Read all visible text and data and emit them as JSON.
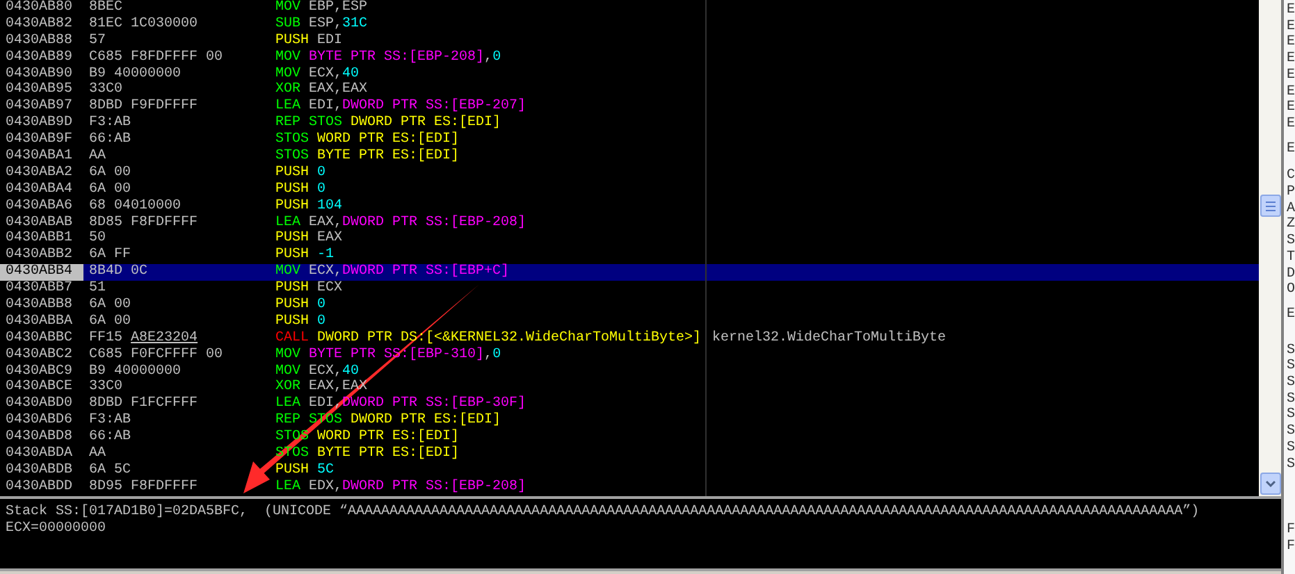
{
  "rows": [
    {
      "address": "0430AB80",
      "hex": "8BEC",
      "selected": false,
      "disasm": [
        {
          "text": "MOV",
          "kind": "op"
        },
        {
          "text": " EBP,ESP",
          "kind": "reg"
        }
      ]
    },
    {
      "address": "0430AB82",
      "hex": "81EC 1C030000",
      "selected": false,
      "disasm": [
        {
          "text": "SUB",
          "kind": "op"
        },
        {
          "text": " ESP,",
          "kind": "reg"
        },
        {
          "text": "31C",
          "kind": "imm"
        }
      ]
    },
    {
      "address": "0430AB88",
      "hex": "57",
      "selected": false,
      "disasm": [
        {
          "text": "PUSH",
          "kind": "stack_op"
        },
        {
          "text": " EDI",
          "kind": "reg"
        }
      ]
    },
    {
      "address": "0430AB89",
      "hex": "C685 F8FDFFFF 00",
      "selected": false,
      "disasm": [
        {
          "text": "MOV",
          "kind": "op"
        },
        {
          "text": " BYTE PTR SS:[EBP-208]",
          "kind": "mem"
        },
        {
          "text": ",",
          "kind": "reg"
        },
        {
          "text": "0",
          "kind": "imm"
        }
      ]
    },
    {
      "address": "0430AB90",
      "hex": "B9 40000000",
      "selected": false,
      "disasm": [
        {
          "text": "MOV",
          "kind": "op"
        },
        {
          "text": " ECX,",
          "kind": "reg"
        },
        {
          "text": "40",
          "kind": "imm"
        }
      ]
    },
    {
      "address": "0430AB95",
      "hex": "33C0",
      "selected": false,
      "disasm": [
        {
          "text": "XOR",
          "kind": "op"
        },
        {
          "text": " EAX,EAX",
          "kind": "reg"
        }
      ]
    },
    {
      "address": "0430AB97",
      "hex": "8DBD F9FDFFFF",
      "selected": false,
      "disasm": [
        {
          "text": "LEA",
          "kind": "op"
        },
        {
          "text": " EDI,",
          "kind": "reg"
        },
        {
          "text": "DWORD PTR SS:[EBP-207]",
          "kind": "mem"
        }
      ]
    },
    {
      "address": "0430AB9D",
      "hex": "F3:AB",
      "selected": false,
      "disasm": [
        {
          "text": "REP STOS",
          "kind": "op"
        },
        {
          "text": " DWORD PTR ES:[EDI]",
          "kind": "ptr"
        }
      ]
    },
    {
      "address": "0430AB9F",
      "hex": "66:AB",
      "selected": false,
      "disasm": [
        {
          "text": "STOS",
          "kind": "op"
        },
        {
          "text": " WORD PTR ES:[EDI]",
          "kind": "ptr"
        }
      ]
    },
    {
      "address": "0430ABA1",
      "hex": "AA",
      "selected": false,
      "disasm": [
        {
          "text": "STOS",
          "kind": "op"
        },
        {
          "text": " BYTE PTR ES:[EDI]",
          "kind": "ptr"
        }
      ]
    },
    {
      "address": "0430ABA2",
      "hex": "6A 00",
      "selected": false,
      "disasm": [
        {
          "text": "PUSH ",
          "kind": "stack_op"
        },
        {
          "text": "0",
          "kind": "imm"
        }
      ]
    },
    {
      "address": "0430ABA4",
      "hex": "6A 00",
      "selected": false,
      "disasm": [
        {
          "text": "PUSH ",
          "kind": "stack_op"
        },
        {
          "text": "0",
          "kind": "imm"
        }
      ]
    },
    {
      "address": "0430ABA6",
      "hex": "68 04010000",
      "selected": false,
      "disasm": [
        {
          "text": "PUSH ",
          "kind": "stack_op"
        },
        {
          "text": "104",
          "kind": "imm"
        }
      ]
    },
    {
      "address": "0430ABAB",
      "hex": "8D85 F8FDFFFF",
      "selected": false,
      "disasm": [
        {
          "text": "LEA",
          "kind": "op"
        },
        {
          "text": " EAX,",
          "kind": "reg"
        },
        {
          "text": "DWORD PTR SS:[EBP-208]",
          "kind": "mem"
        }
      ]
    },
    {
      "address": "0430ABB1",
      "hex": "50",
      "selected": false,
      "disasm": [
        {
          "text": "PUSH",
          "kind": "stack_op"
        },
        {
          "text": " EAX",
          "kind": "reg"
        }
      ]
    },
    {
      "address": "0430ABB2",
      "hex": "6A FF",
      "selected": false,
      "disasm": [
        {
          "text": "PUSH ",
          "kind": "stack_op"
        },
        {
          "text": "-1",
          "kind": "imm"
        }
      ]
    },
    {
      "address": "0430ABB4",
      "hex": "8B4D 0C",
      "selected": true,
      "disasm": [
        {
          "text": "MOV",
          "kind": "op"
        },
        {
          "text": " ECX,",
          "kind": "reg"
        },
        {
          "text": "DWORD PTR SS:[EBP+C]",
          "kind": "mem"
        }
      ]
    },
    {
      "address": "0430ABB7",
      "hex": "51",
      "selected": false,
      "disasm": [
        {
          "text": "PUSH",
          "kind": "stack_op"
        },
        {
          "text": " ECX",
          "kind": "reg"
        }
      ]
    },
    {
      "address": "0430ABB8",
      "hex": "6A 00",
      "selected": false,
      "disasm": [
        {
          "text": "PUSH ",
          "kind": "stack_op"
        },
        {
          "text": "0",
          "kind": "imm"
        }
      ]
    },
    {
      "address": "0430ABBA",
      "hex": "6A 00",
      "selected": false,
      "disasm": [
        {
          "text": "PUSH ",
          "kind": "stack_op"
        },
        {
          "text": "0",
          "kind": "imm"
        }
      ]
    },
    {
      "address": "0430ABBC",
      "hex": "FF15",
      "hex_target": "A8E23204",
      "selected": false,
      "disasm": [
        {
          "text": "CALL",
          "kind": "call"
        },
        {
          "text": " DWORD PTR DS:[<&KERNEL32.WideCharToMultiByte>]",
          "kind": "ptr"
        }
      ],
      "comment": "kernel32.WideCharToMultiByte"
    },
    {
      "address": "0430ABC2",
      "hex": "C685 F0FCFFFF 00",
      "selected": false,
      "disasm": [
        {
          "text": "MOV",
          "kind": "op"
        },
        {
          "text": " BYTE PTR SS:[EBP-310]",
          "kind": "mem"
        },
        {
          "text": ",",
          "kind": "reg"
        },
        {
          "text": "0",
          "kind": "imm"
        }
      ]
    },
    {
      "address": "0430ABC9",
      "hex": "B9 40000000",
      "selected": false,
      "disasm": [
        {
          "text": "MOV",
          "kind": "op"
        },
        {
          "text": " ECX,",
          "kind": "reg"
        },
        {
          "text": "40",
          "kind": "imm"
        }
      ]
    },
    {
      "address": "0430ABCE",
      "hex": "33C0",
      "selected": false,
      "disasm": [
        {
          "text": "XOR",
          "kind": "op"
        },
        {
          "text": " EAX,EAX",
          "kind": "reg"
        }
      ]
    },
    {
      "address": "0430ABD0",
      "hex": "8DBD F1FCFFFF",
      "selected": false,
      "disasm": [
        {
          "text": "LEA",
          "kind": "op"
        },
        {
          "text": " EDI,",
          "kind": "reg"
        },
        {
          "text": "DWORD PTR SS:[EBP-30F]",
          "kind": "mem"
        }
      ]
    },
    {
      "address": "0430ABD6",
      "hex": "F3:AB",
      "selected": false,
      "disasm": [
        {
          "text": "REP STOS",
          "kind": "op"
        },
        {
          "text": " DWORD PTR ES:[EDI]",
          "kind": "ptr"
        }
      ]
    },
    {
      "address": "0430ABD8",
      "hex": "66:AB",
      "selected": false,
      "disasm": [
        {
          "text": "STOS",
          "kind": "op"
        },
        {
          "text": " WORD PTR ES:[EDI]",
          "kind": "ptr"
        }
      ]
    },
    {
      "address": "0430ABDA",
      "hex": "AA",
      "selected": false,
      "disasm": [
        {
          "text": "STOS",
          "kind": "op"
        },
        {
          "text": " BYTE PTR ES:[EDI]",
          "kind": "ptr"
        }
      ]
    },
    {
      "address": "0430ABDB",
      "hex": "6A 5C",
      "selected": false,
      "disasm": [
        {
          "text": "PUSH ",
          "kind": "stack_op"
        },
        {
          "text": "5C",
          "kind": "imm"
        }
      ]
    },
    {
      "address": "0430ABDD",
      "hex": "8D95 F8FDFFFF",
      "selected": false,
      "disasm": [
        {
          "text": "LEA",
          "kind": "op"
        },
        {
          "text": " EDX,",
          "kind": "reg"
        },
        {
          "text": "DWORD PTR SS:[EBP-208]",
          "kind": "mem"
        }
      ]
    }
  ],
  "info_pane": {
    "lines": [
      "Stack SS:[017AD1B0]=02DA5BFC,  (UNICODE “AAAAAAAAAAAAAAAAAAAAAAAAAAAAAAAAAAAAAAAAAAAAAAAAAAAAAAAAAAAAAAAAAAAAAAAAAAAAAAAAAAAAAAAAAAAAAAAAAAAA”)",
      "ECX=00000000"
    ]
  },
  "register_pane": {
    "groups": [
      [
        "E",
        "E",
        "E",
        "E",
        "E",
        "E",
        "E",
        "E"
      ],
      [
        "E"
      ],
      [
        "C",
        "P",
        "A",
        "Z",
        "S",
        "T",
        "D",
        "O"
      ],
      [
        "E"
      ],
      [
        "S",
        "S",
        "S",
        "S",
        "S",
        "S",
        "S",
        "S"
      ],
      [
        "F",
        "F"
      ]
    ]
  }
}
